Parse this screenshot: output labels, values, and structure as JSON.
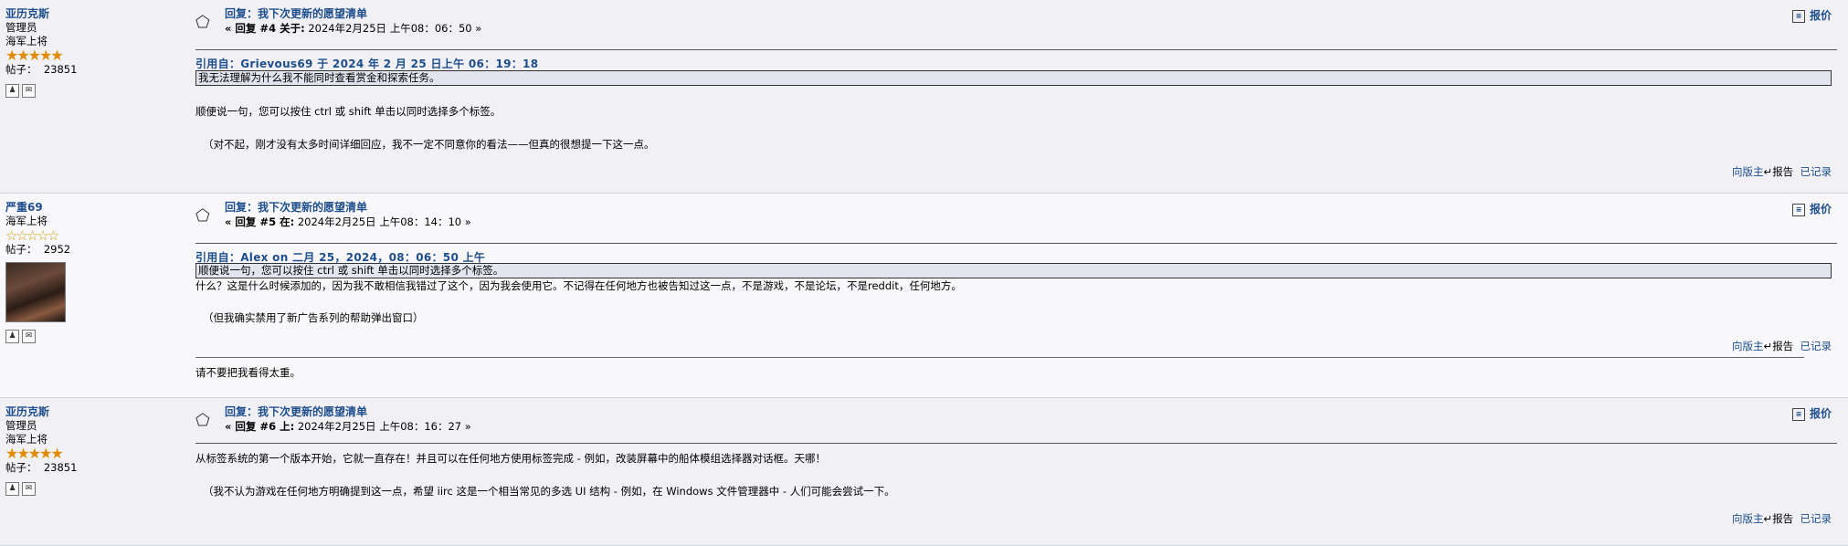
{
  "posts": [
    {
      "poster": {
        "name": "亚历克斯",
        "role": "管理员",
        "rank": "海军上将",
        "stars": "★★★★★",
        "posts_label": "帖子：",
        "posts_count": "23851"
      },
      "title": "回复：我下次更新的愿望清单",
      "reply_no": "« 回复 #4 关于:",
      "date": "2024年2月25日 上午08：06：50 »",
      "quote_button": "报价",
      "quote_header": "引用自：Grievous69 于 2024 年 2 月 25 日上午 06：19：18",
      "quote_text": "我无法理解为什么我不能同时查看赏金和探索任务。",
      "body1": "顺便说一句，您可以按住 ctrl 或 shift 单击以同时选择多个标签。",
      "body2": "（对不起，刚才没有太多时间详细回应，我不一定不同意你的看法——但真的很想提一下这一点。",
      "report_link": "向版主",
      "report_suffix": "报告",
      "logged": "已记录"
    },
    {
      "poster": {
        "name": "严重69",
        "rank": "海军上将",
        "stars": "☆☆☆☆☆",
        "posts_label": "帖子：",
        "posts_count": "2952"
      },
      "title": "回复：我下次更新的愿望清单",
      "reply_no": "« 回复 #5 在:",
      "date": "2024年2月25日 上午08：14：10 »",
      "quote_button": "报价",
      "quote_header": "引用自：Alex on 二月 25，2024，08：06：50 上午",
      "quote_text": "顺便说一句，您可以按住 ctrl 或 shift 单击以同时选择多个标签。",
      "body1": "什么？这是什么时候添加的，因为我不敢相信我错过了这个，因为我会使用它。不记得在任何地方也被告知过这一点，不是游戏，不是论坛，不是reddit，任何地方。",
      "body2": "（但我确实禁用了新广告系列的帮助弹出窗口）",
      "report_link": "向版主",
      "report_suffix": "报告",
      "logged": "已记录",
      "signature": "请不要把我看得太重。"
    },
    {
      "poster": {
        "name": "亚历克斯",
        "role": "管理员",
        "rank": "海军上将",
        "stars": "★★★★★",
        "posts_label": "帖子：",
        "posts_count": "23851"
      },
      "title": "回复：我下次更新的愿望清单",
      "reply_no": "« 回复 #6 上:",
      "date": "2024年2月25日 上午08：16：27 »",
      "quote_button": "报价",
      "body1": "从标签系统的第一个版本开始，它就一直存在！并且可以在任何地方使用标签完成 - 例如，改装屏幕中的船体模组选择器对话框。天哪！",
      "body2": "（我不认为游戏在任何地方明确提到这一点，希望 iirc 这是一个相当常见的多选 UI 结构 - 例如，在 Windows 文件管理器中 - 人们可能会尝试一下。",
      "report_link": "向版主",
      "report_suffix": "报告",
      "logged": "已记录"
    }
  ]
}
